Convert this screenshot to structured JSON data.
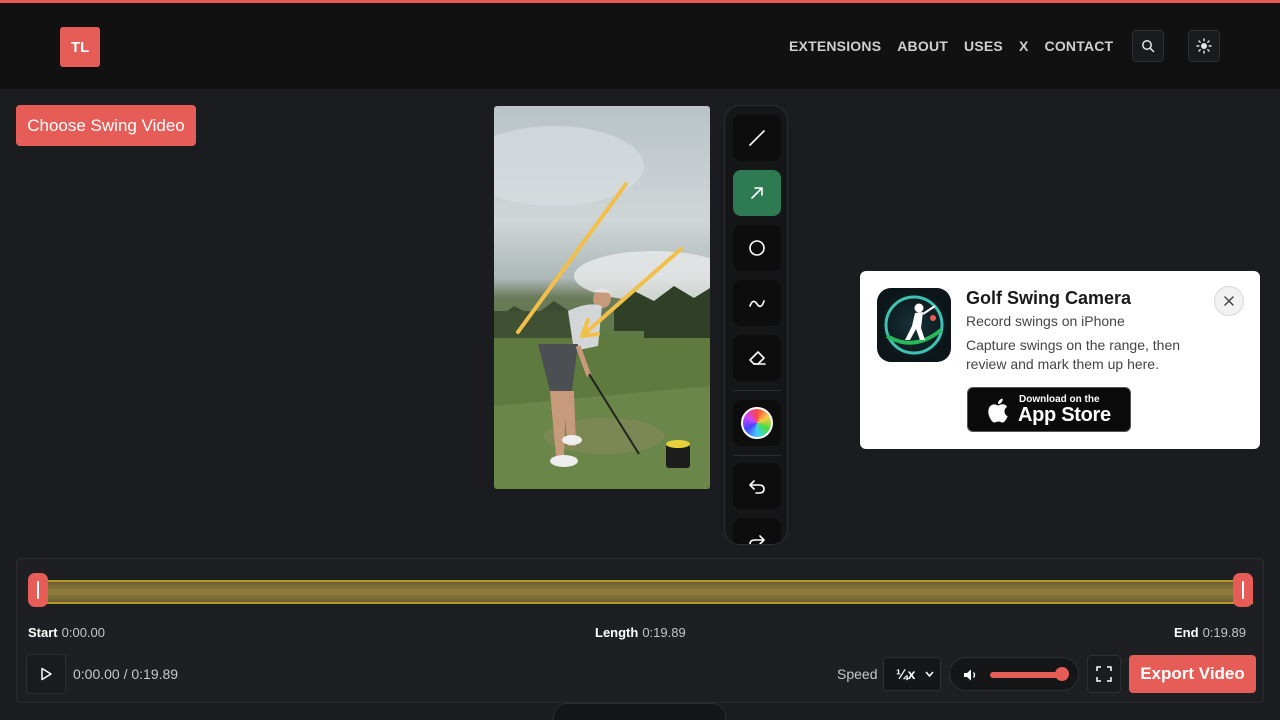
{
  "brand": {
    "logo_text": "TL",
    "accent": "#e65c57"
  },
  "nav": {
    "items": [
      "EXTENSIONS",
      "ABOUT",
      "USES",
      "X",
      "CONTACT"
    ],
    "search_icon": "search-icon",
    "theme_icon": "sun-icon"
  },
  "editor": {
    "choose_label": "Choose Swing Video",
    "tools": [
      {
        "name": "line-tool",
        "icon": "line-icon",
        "active": false
      },
      {
        "name": "arrow-tool",
        "icon": "arrow-icon",
        "active": true
      },
      {
        "name": "circle-tool",
        "icon": "circle-icon",
        "active": false
      },
      {
        "name": "freehand-tool",
        "icon": "curve-icon",
        "active": false
      },
      {
        "name": "eraser-tool",
        "icon": "eraser-icon",
        "active": false
      },
      {
        "name": "color-picker",
        "icon": "color-wheel-icon",
        "active": false
      },
      {
        "name": "undo-tool",
        "icon": "undo-icon",
        "active": false
      },
      {
        "name": "redo-tool",
        "icon": "redo-icon",
        "active": false
      }
    ],
    "active_tool_color": "#2e7a53",
    "annotation_color": "#f2c04a"
  },
  "promo": {
    "title": "Golf Swing Camera",
    "subtitle": "Record swings on iPhone",
    "description": "Capture swings on the range, then review and mark them up here.",
    "store_small": "Download on the",
    "store_big": "App Store"
  },
  "timeline": {
    "start_label": "Start",
    "start_value": "0:00.00",
    "length_label": "Length",
    "length_value": "0:19.89",
    "end_label": "End",
    "end_value": "0:19.89",
    "time_readout": "0:00.00 / 0:19.89",
    "speed_label": "Speed",
    "speed_value": "¼x",
    "volume_level": 1.0,
    "export_label": "Export Video"
  }
}
